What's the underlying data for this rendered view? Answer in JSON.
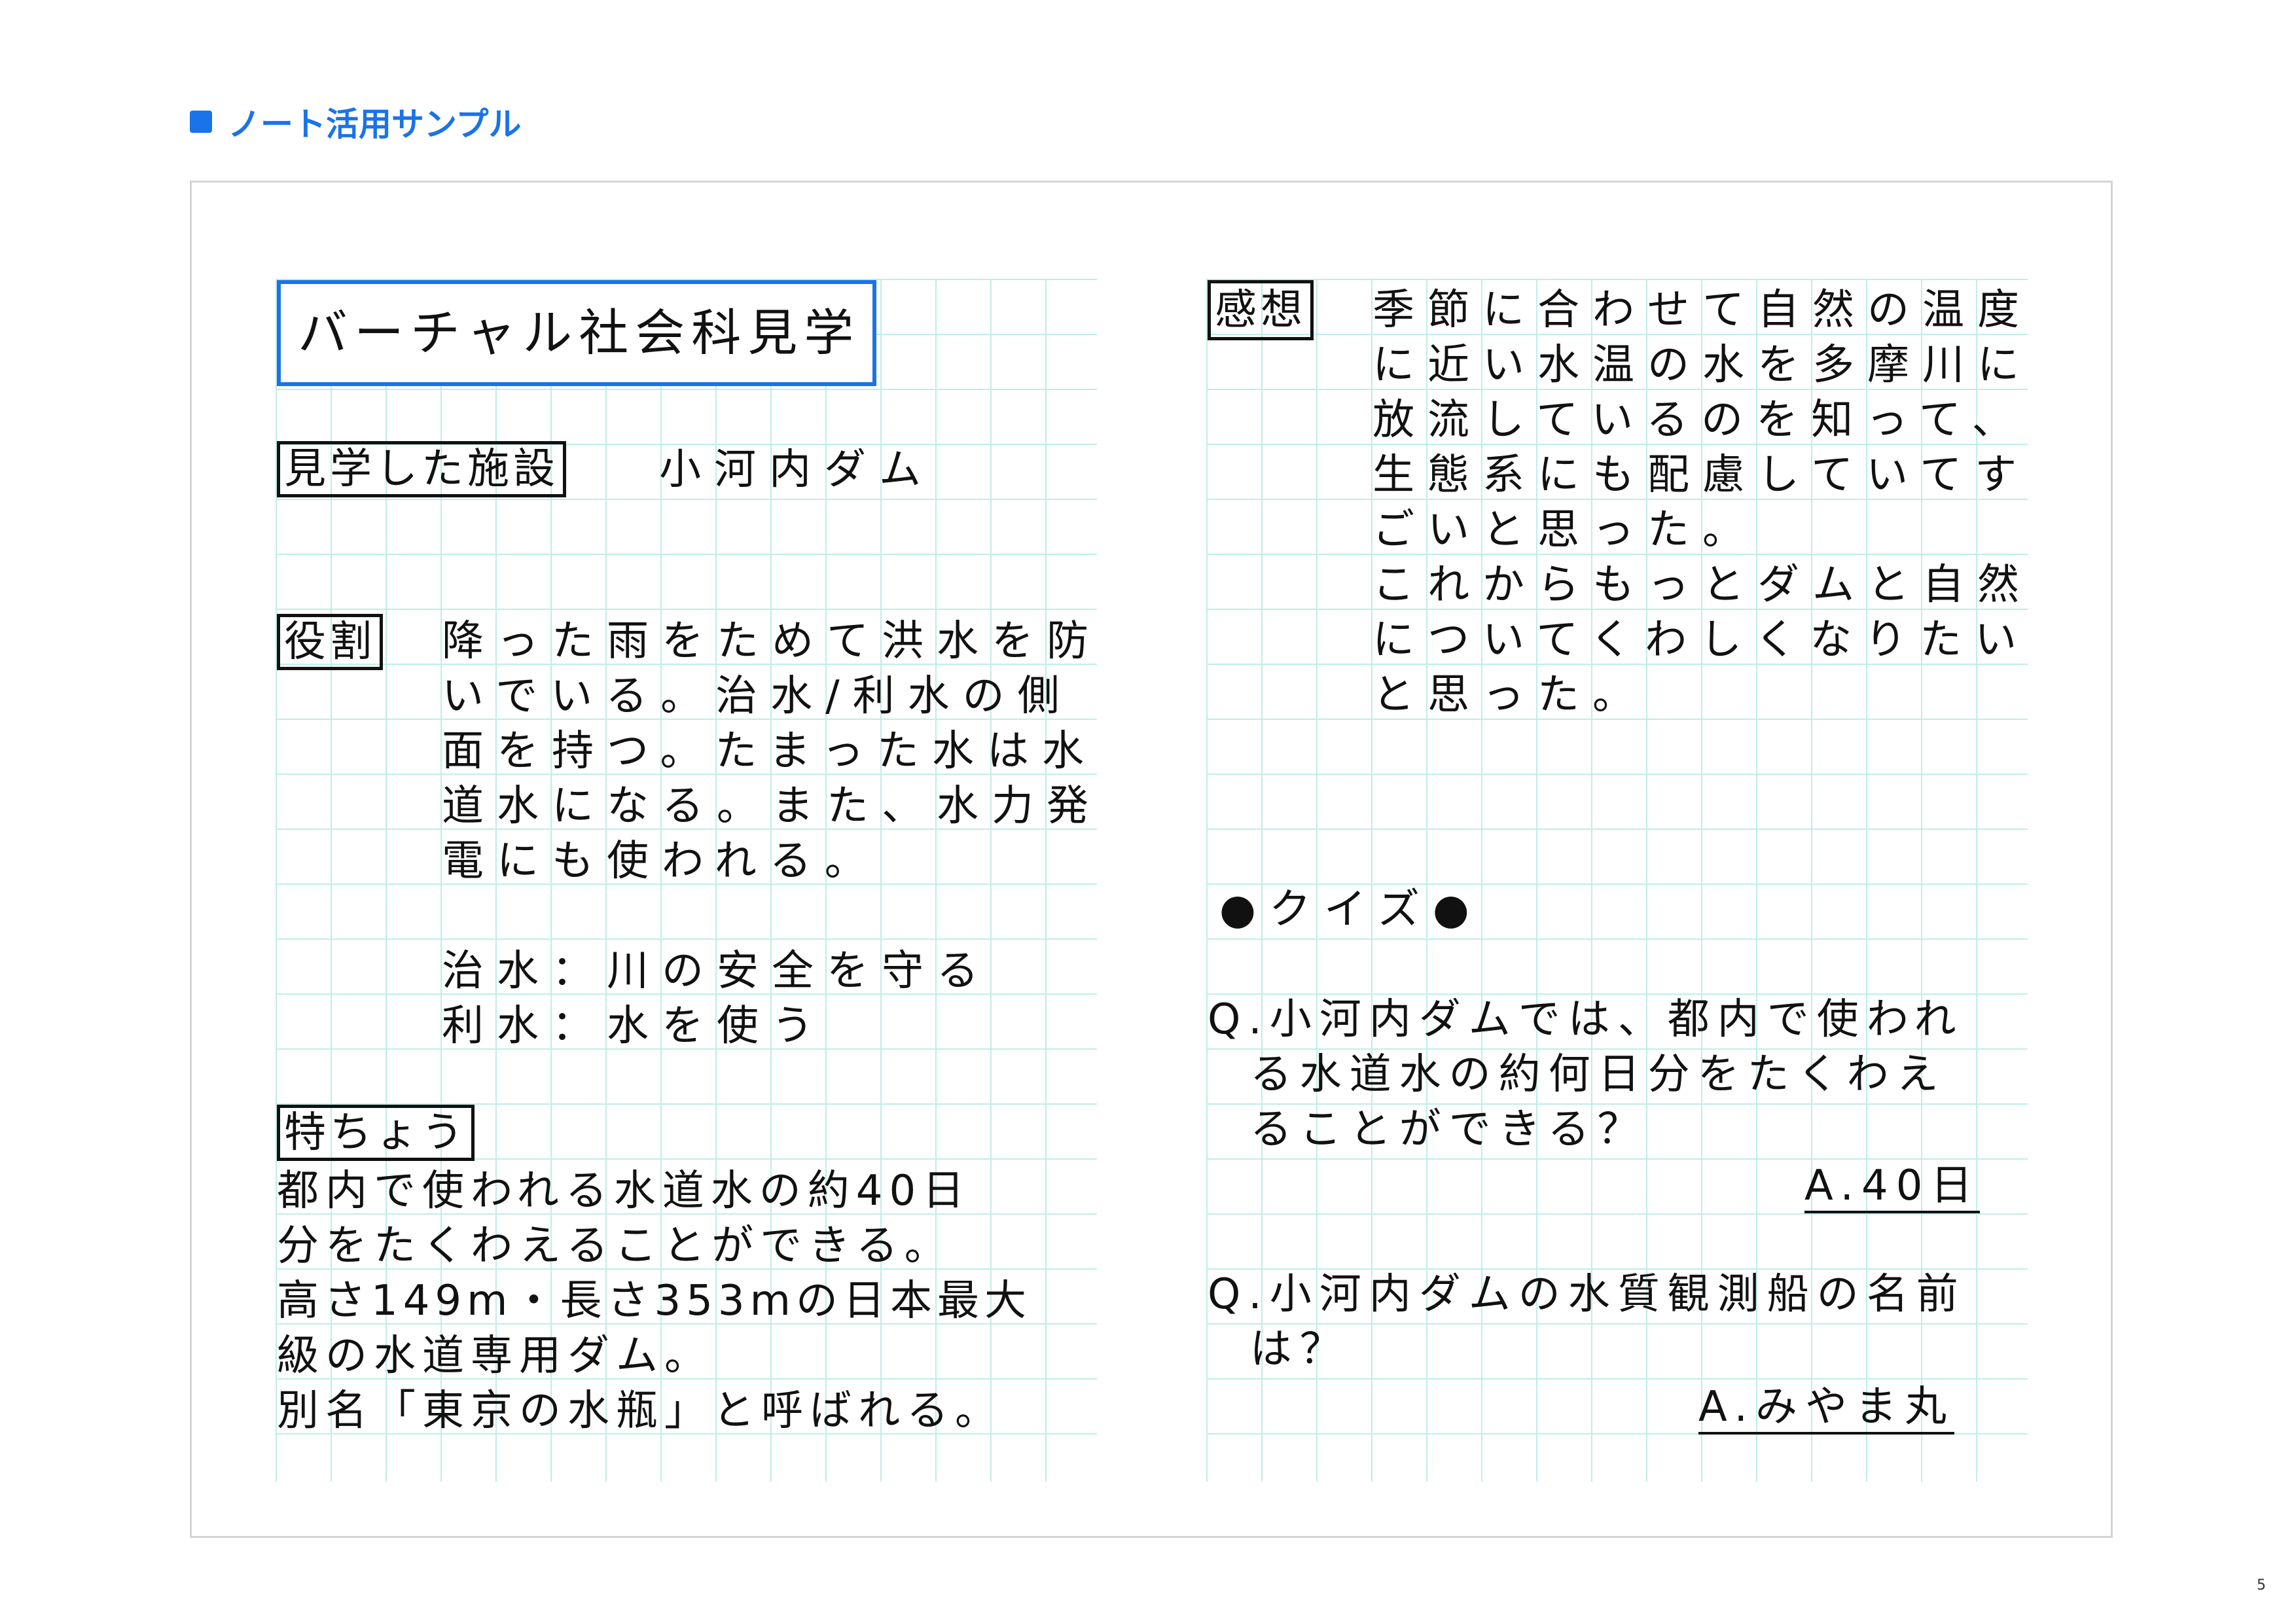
{
  "header": {
    "title": "ノート活用サンプル"
  },
  "page_number": "5",
  "left": {
    "title": "バーチャル社会科見学",
    "facility": {
      "label": "見学した施設",
      "value": "小河内ダム"
    },
    "role": {
      "label": "役割",
      "lines": [
        "降った雨をためて洪水を防",
        "いでいる。治水/利水の側",
        "面を持つ。たまった水は水",
        "道水になる。また、水力発",
        "電にも使われる。"
      ],
      "definitions": [
        "治水：川の安全を守る",
        "利水：水を使う"
      ]
    },
    "features": {
      "label": "特ちょう",
      "lines": [
        "都内で使われる水道水の約40日",
        "分をたくわえることができる。",
        "高さ149m・長さ353mの日本最大",
        "級の水道専用ダム。",
        "別名「東京の水瓶」と呼ばれる。"
      ]
    }
  },
  "right": {
    "impression": {
      "label": "感想",
      "lines": [
        "季節に合わせて自然の温度",
        "に近い水温の水を多摩川に",
        "放流しているのを知って、",
        "生態系にも配慮していてす",
        "ごいと思った。",
        "これからもっとダムと自然",
        "についてくわしくなりたい",
        "と思った。"
      ]
    },
    "quiz": {
      "heading": "●クイズ●",
      "q1": {
        "lines": [
          "Q.小河内ダムでは、都内で使われ",
          "  る水道水の約何日分をたくわえ",
          "  ることができる？"
        ],
        "answer": "A.40日"
      },
      "q2": {
        "lines": [
          "Q.小河内ダムの水質観測船の名前",
          "  は？"
        ],
        "answer": "A.みやま丸"
      }
    }
  }
}
